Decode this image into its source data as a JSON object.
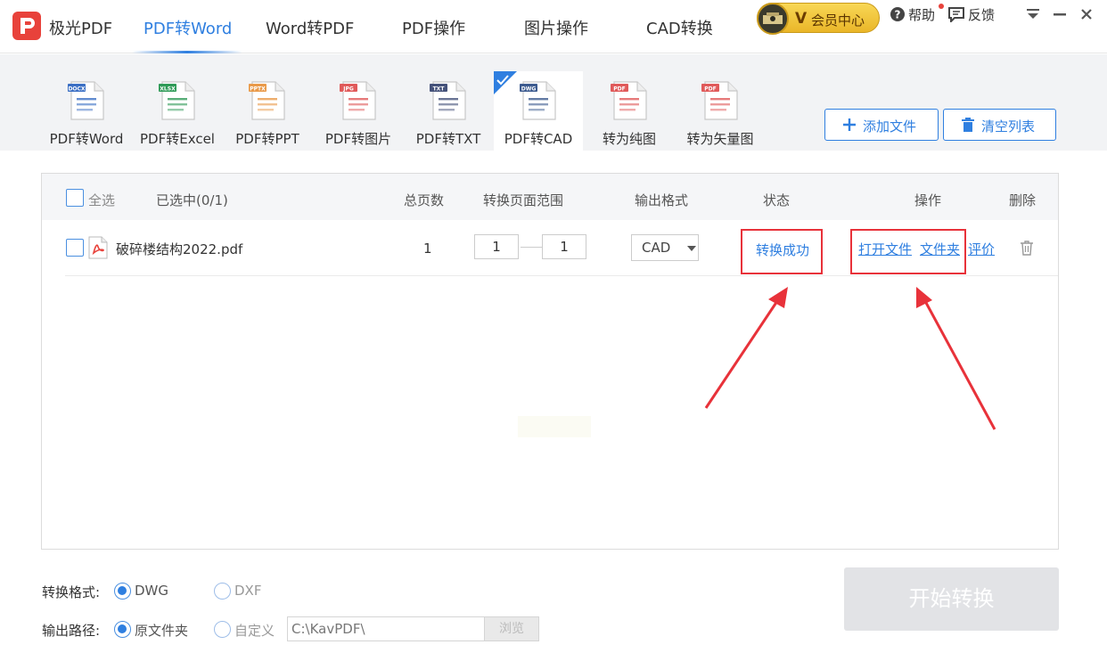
{
  "app": {
    "name": "极光PDF"
  },
  "nav": {
    "tabs": [
      {
        "label": "PDF转Word"
      },
      {
        "label": "Word转PDF"
      },
      {
        "label": "PDF操作"
      },
      {
        "label": "图片操作"
      },
      {
        "label": "CAD转换"
      }
    ],
    "active": "PDF转Word"
  },
  "topbar": {
    "vip_badge": "V",
    "vip_label": "会员中心",
    "help": "帮助",
    "feedback": "反馈"
  },
  "tools": [
    {
      "label": "PDF转Word",
      "badge": "DOCX",
      "color": "#3b6fc4",
      "icon": "word-doc-icon"
    },
    {
      "label": "PDF转Excel",
      "badge": "XLSX",
      "color": "#2f9a57",
      "icon": "excel-doc-icon"
    },
    {
      "label": "PDF转PPT",
      "badge": "PPTX",
      "color": "#e99a4a",
      "icon": "ppt-doc-icon"
    },
    {
      "label": "PDF转图片",
      "badge": "JPG",
      "color": "#e05a5a",
      "icon": "image-doc-icon"
    },
    {
      "label": "PDF转TXT",
      "badge": "TXT",
      "color": "#45527a",
      "icon": "txt-doc-icon"
    },
    {
      "label": "PDF转CAD",
      "badge": "DWG",
      "color": "#3d5b8f",
      "icon": "cad-doc-icon",
      "selected": true
    },
    {
      "label": "转为纯图",
      "badge": "PDF",
      "color": "#e05a5a",
      "icon": "pure-image-doc-icon"
    },
    {
      "label": "转为矢量图",
      "badge": "PDF",
      "color": "#e05a5a",
      "icon": "vector-doc-icon"
    }
  ],
  "actions": {
    "add_file": "添加文件",
    "clear_list": "清空列表"
  },
  "table": {
    "headers": {
      "select_all": "全选",
      "selected": "已选中(0/1)",
      "pages": "总页数",
      "range": "转换页面范围",
      "format": "输出格式",
      "status": "状态",
      "operation": "操作",
      "delete": "删除"
    },
    "rows": [
      {
        "filename": "破碎楼结构2022.pdf",
        "pages": "1",
        "range_from": "1",
        "range_to": "1",
        "format": "CAD",
        "status": "转换成功",
        "op_open": "打开文件",
        "op_folder": "文件夹",
        "op_rate": "评价"
      }
    ]
  },
  "options": {
    "format_label": "转换格式:",
    "format_dwg": "DWG",
    "format_dxf": "DXF",
    "format_selected": "DWG",
    "output_label": "输出路径:",
    "output_original": "原文件夹",
    "output_custom": "自定义",
    "output_selected": "原文件夹",
    "path_value": "C:\\KavPDF\\",
    "browse": "浏览"
  },
  "start_button": "开始转换",
  "colors": {
    "accent": "#2f7fe0",
    "brand": "#e8423b",
    "highlight": "#e8323a"
  }
}
